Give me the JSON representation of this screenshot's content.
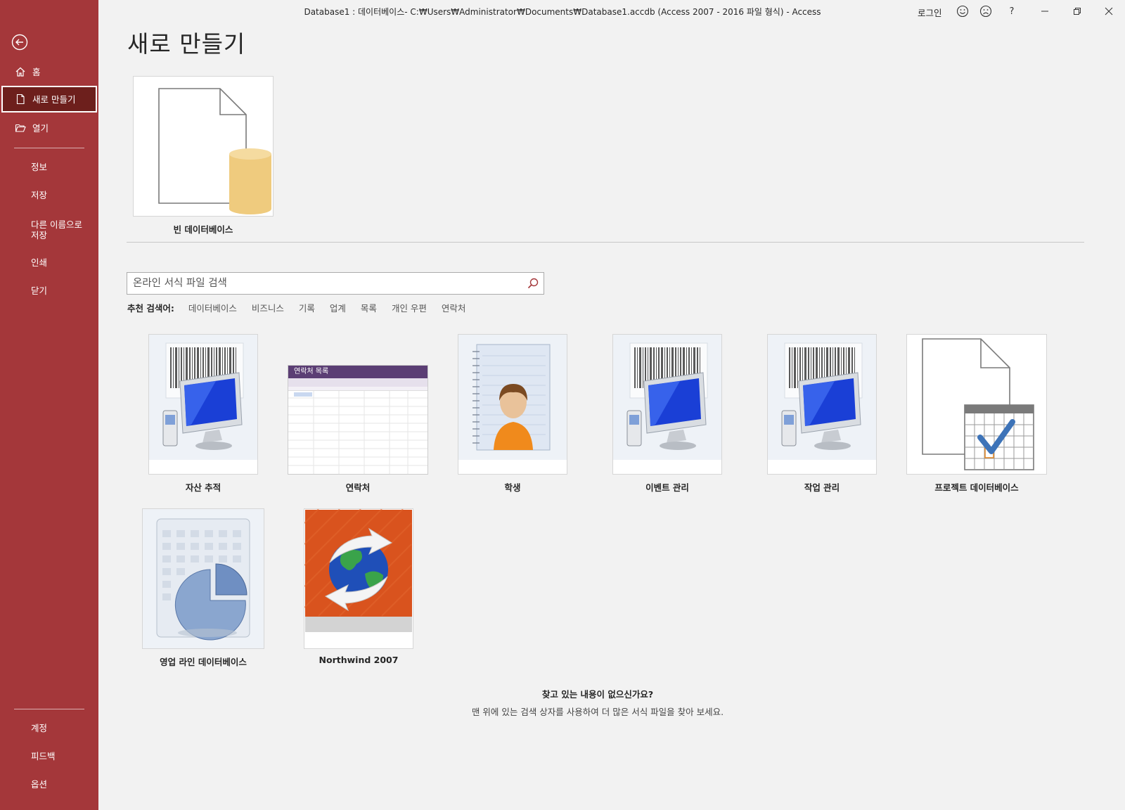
{
  "window": {
    "title": "Database1 : 데이터베이스- C:₩Users₩Administrator₩Documents₩Database1.accdb (Access 2007 - 2016 파일 형식)  -  Access",
    "login": "로그인",
    "help": "?"
  },
  "sidebar": {
    "items": [
      {
        "label": "홈",
        "icon": "home-icon"
      },
      {
        "label": "새로 만들기",
        "icon": "new-document-icon",
        "active": true
      },
      {
        "label": "열기",
        "icon": "open-folder-icon"
      },
      {
        "label": "정보"
      },
      {
        "label": "저장"
      },
      {
        "label": "다른 이름으로\n저장"
      },
      {
        "label": "인쇄"
      },
      {
        "label": "닫기"
      }
    ],
    "bottom": [
      {
        "label": "계정"
      },
      {
        "label": "피드백"
      },
      {
        "label": "옵션"
      }
    ]
  },
  "main": {
    "title": "새로 만들기",
    "blank_db": {
      "label": "빈 데이터베이스"
    },
    "search": {
      "placeholder": "온라인 서식 파일 검색"
    },
    "suggested": {
      "label": "추천 검색어:",
      "items": [
        "데이터베이스",
        "비즈니스",
        "기록",
        "업계",
        "목록",
        "개인 우편",
        "연락처"
      ]
    },
    "templates": [
      {
        "label": "자산 추적"
      },
      {
        "label": "연락처",
        "thumb_title": "연락처 목록"
      },
      {
        "label": "학생"
      },
      {
        "label": "이벤트 관리"
      },
      {
        "label": "작업 관리"
      },
      {
        "label": "프로젝트 데이터베이스"
      },
      {
        "label": "영업 라인 데이터베이스"
      },
      {
        "label": "Northwind 2007"
      }
    ],
    "not_found": {
      "heading": "찾고 있는 내용이 없으신가요?",
      "text": "맨 위에 있는 검색 상자를 사용하여 더 많은 서식 파일을 찾아 보세요."
    }
  },
  "colors": {
    "sidebar": "#a4373a",
    "sidebar_active": "#6d1f1c",
    "background": "#f2f2f2",
    "db_cylinder": "#efcb7e",
    "northwind_orange": "#d9531e"
  }
}
